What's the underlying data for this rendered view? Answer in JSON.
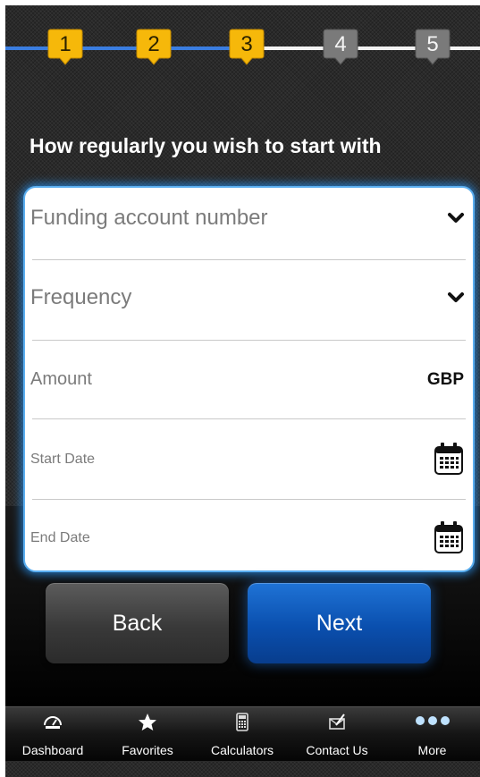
{
  "steps": [
    {
      "label": "1",
      "state": "done"
    },
    {
      "label": "2",
      "state": "done"
    },
    {
      "label": "3",
      "state": "done"
    },
    {
      "label": "4",
      "state": "todo"
    },
    {
      "label": "5",
      "state": "todo"
    }
  ],
  "heading": "How regularly you wish to start with",
  "form": {
    "funding_account_placeholder": "Funding account number",
    "frequency_placeholder": "Frequency",
    "amount_placeholder": "Amount",
    "amount_currency": "GBP",
    "start_date_placeholder": "Start Date",
    "end_date_placeholder": "End Date"
  },
  "buttons": {
    "back": "Back",
    "next": "Next"
  },
  "tabbar": {
    "items": [
      {
        "label": "Dashboard",
        "icon": "dashboard-icon"
      },
      {
        "label": "Favorites",
        "icon": "star-icon"
      },
      {
        "label": "Calculators",
        "icon": "calculator-icon"
      },
      {
        "label": "Contact Us",
        "icon": "contact-icon"
      },
      {
        "label": "More",
        "icon": "more-icon"
      }
    ]
  },
  "colors": {
    "step_done": "#f6b80a",
    "step_todo": "#7a7a7a",
    "track_done": "#3a7de0",
    "track_todo": "#f2f2f2",
    "next_button": "#0a4fae",
    "card_glow": "#5aaef0"
  }
}
